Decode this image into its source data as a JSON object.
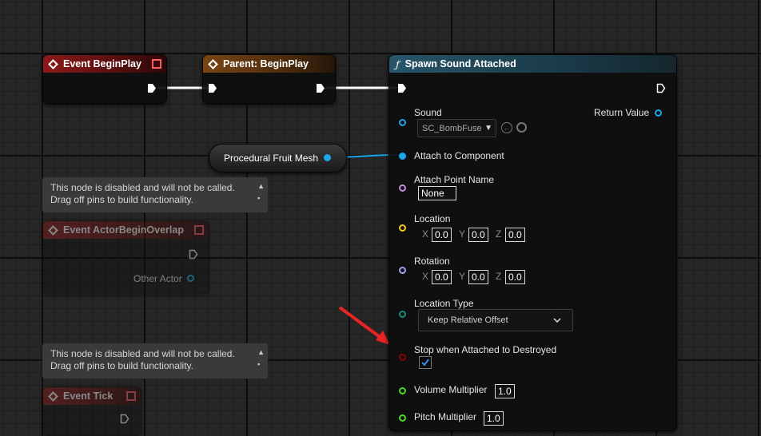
{
  "nodes": {
    "begin_play": {
      "title": "Event BeginPlay"
    },
    "parent_begin_play": {
      "title": "Parent: BeginPlay"
    },
    "spawn": {
      "title": "Spawn Sound Attached",
      "sound_label": "Sound",
      "sound_value": "SC_BombFuse",
      "return_label": "Return Value",
      "attach_component": "Attach to Component",
      "attach_point_label": "Attach Point Name",
      "attach_point_value": "None",
      "location_label": "Location",
      "rotation_label": "Rotation",
      "axis_x": "X",
      "axis_y": "Y",
      "axis_z": "Z",
      "loc_x": "0.0",
      "loc_y": "0.0",
      "loc_z": "0.0",
      "rot_x": "0.0",
      "rot_y": "0.0",
      "rot_z": "0.0",
      "location_type_label": "Location Type",
      "location_type_value": "Keep Relative Offset",
      "stop_label": "Stop when Attached to Destroyed",
      "volume_label": "Volume Multiplier",
      "volume_value": "1.0",
      "pitch_label": "Pitch Multiplier",
      "pitch_value": "1.0"
    },
    "fruit_mesh": {
      "title": "Procedural Fruit Mesh"
    },
    "overlap": {
      "title": "Event ActorBeginOverlap",
      "pin": "Other Actor"
    },
    "tick": {
      "title": "Event Tick"
    }
  },
  "comments": {
    "disabled_1": {
      "line1": "This node is disabled and will not be called.",
      "line2": "Drag off pins to build functionality."
    },
    "disabled_2": {
      "line1": "This node is disabled and will not be called.",
      "line2": "Drag off pins to build functionality."
    }
  },
  "colors": {
    "object_pin": "#1aa6ea",
    "name_pin": "#c98ae6",
    "vector_pin": "#f5c81a",
    "rotator_pin": "#9ea5f5",
    "enum_pin": "#138c7a",
    "bool_pin": "#8c0000",
    "float_pin": "#4cd923",
    "annotation_arrow": "#e82424"
  }
}
